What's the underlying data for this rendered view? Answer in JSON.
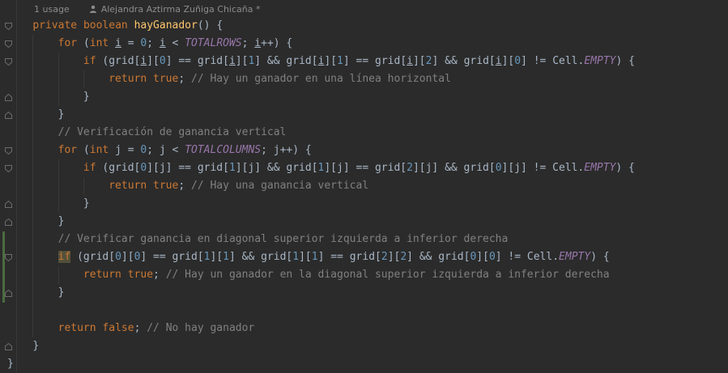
{
  "hint": {
    "usages": "1 usage",
    "author": "Alejandra Aztirma Zuñiga Chicaña *"
  },
  "code": [
    {
      "indent": 4,
      "tokens": [
        [
          "kw",
          "private "
        ],
        [
          "kw",
          "boolean "
        ],
        [
          "fn",
          "hayGanador"
        ],
        [
          "p",
          "() {"
        ]
      ]
    },
    {
      "indent": 8,
      "tokens": [
        [
          "kw",
          "for "
        ],
        [
          "p",
          "("
        ],
        [
          "kw",
          "int "
        ],
        [
          "ul",
          "i"
        ],
        [
          "p",
          " = "
        ],
        [
          "num",
          "0"
        ],
        [
          "p",
          "; "
        ],
        [
          "ul",
          "i"
        ],
        [
          "p",
          " < "
        ],
        [
          "cst",
          "TOTALROWS"
        ],
        [
          "p",
          "; "
        ],
        [
          "ul",
          "i"
        ],
        [
          "p",
          "++) {"
        ]
      ]
    },
    {
      "indent": 12,
      "tokens": [
        [
          "kw",
          "if "
        ],
        [
          "p",
          "(grid["
        ],
        [
          "ul",
          "i"
        ],
        [
          "p",
          "]["
        ],
        [
          "num",
          "0"
        ],
        [
          "p",
          "] == grid["
        ],
        [
          "ul",
          "i"
        ],
        [
          "p",
          "]["
        ],
        [
          "num",
          "1"
        ],
        [
          "p",
          "] && grid["
        ],
        [
          "ul",
          "i"
        ],
        [
          "p",
          "]["
        ],
        [
          "num",
          "1"
        ],
        [
          "p",
          "] == grid["
        ],
        [
          "ul",
          "i"
        ],
        [
          "p",
          "]["
        ],
        [
          "num",
          "2"
        ],
        [
          "p",
          "] && grid["
        ],
        [
          "ul",
          "i"
        ],
        [
          "p",
          "]["
        ],
        [
          "num",
          "0"
        ],
        [
          "p",
          "] != Cell."
        ],
        [
          "cst",
          "EMPTY"
        ],
        [
          "p",
          ") {"
        ]
      ]
    },
    {
      "indent": 16,
      "tokens": [
        [
          "kw",
          "return "
        ],
        [
          "kw",
          "true"
        ],
        [
          "p",
          "; "
        ],
        [
          "cmt",
          "// Hay un ganador en una línea horizontal"
        ]
      ]
    },
    {
      "indent": 12,
      "tokens": [
        [
          "p",
          "}"
        ]
      ]
    },
    {
      "indent": 8,
      "tokens": [
        [
          "p",
          "}"
        ]
      ]
    },
    {
      "indent": 8,
      "tokens": [
        [
          "cmt",
          "// Verificación de ganancia vertical"
        ]
      ]
    },
    {
      "indent": 8,
      "tokens": [
        [
          "kw",
          "for "
        ],
        [
          "p",
          "("
        ],
        [
          "kw",
          "int "
        ],
        [
          "p",
          "j = "
        ],
        [
          "num",
          "0"
        ],
        [
          "p",
          "; j < "
        ],
        [
          "cst",
          "TOTALCOLUMNS"
        ],
        [
          "p",
          "; j++) {"
        ]
      ]
    },
    {
      "indent": 12,
      "tokens": [
        [
          "kw",
          "if "
        ],
        [
          "p",
          "(grid["
        ],
        [
          "num",
          "0"
        ],
        [
          "p",
          "][j] == grid["
        ],
        [
          "num",
          "1"
        ],
        [
          "p",
          "][j] && grid["
        ],
        [
          "num",
          "1"
        ],
        [
          "p",
          "][j] == grid["
        ],
        [
          "num",
          "2"
        ],
        [
          "p",
          "][j] && grid["
        ],
        [
          "num",
          "0"
        ],
        [
          "p",
          "][j] != Cell."
        ],
        [
          "cst",
          "EMPTY"
        ],
        [
          "p",
          ") {"
        ]
      ]
    },
    {
      "indent": 16,
      "tokens": [
        [
          "kw",
          "return "
        ],
        [
          "kw",
          "true"
        ],
        [
          "p",
          "; "
        ],
        [
          "cmt",
          "// Hay una ganancia vertical"
        ]
      ]
    },
    {
      "indent": 12,
      "tokens": [
        [
          "p",
          "}"
        ]
      ]
    },
    {
      "indent": 8,
      "tokens": [
        [
          "p",
          "}"
        ]
      ]
    },
    {
      "indent": 8,
      "tokens": [
        [
          "cmt",
          "// Verificar ganancia en diagonal superior izquierda a inferior derecha"
        ]
      ]
    },
    {
      "indent": 8,
      "tokens": [
        [
          "kwhl",
          "if"
        ],
        [
          "p",
          " (grid["
        ],
        [
          "num",
          "0"
        ],
        [
          "p",
          "]["
        ],
        [
          "num",
          "0"
        ],
        [
          "p",
          "] == grid["
        ],
        [
          "num",
          "1"
        ],
        [
          "p",
          "]["
        ],
        [
          "num",
          "1"
        ],
        [
          "p",
          "] && grid["
        ],
        [
          "num",
          "1"
        ],
        [
          "p",
          "]["
        ],
        [
          "num",
          "1"
        ],
        [
          "p",
          "] == grid["
        ],
        [
          "num",
          "2"
        ],
        [
          "p",
          "]["
        ],
        [
          "num",
          "2"
        ],
        [
          "p",
          "] && grid["
        ],
        [
          "num",
          "0"
        ],
        [
          "p",
          "]["
        ],
        [
          "num",
          "0"
        ],
        [
          "p",
          "] != Cell."
        ],
        [
          "cst",
          "EMPTY"
        ],
        [
          "p",
          ") {"
        ]
      ]
    },
    {
      "indent": 12,
      "tokens": [
        [
          "kw",
          "return "
        ],
        [
          "kw",
          "true"
        ],
        [
          "p",
          "; "
        ],
        [
          "cmt",
          "// Hay un ganador en la diagonal superior izquierda a inferior derecha"
        ]
      ]
    },
    {
      "indent": 8,
      "tokens": [
        [
          "p",
          "}"
        ]
      ]
    },
    {
      "indent": 0,
      "tokens": []
    },
    {
      "indent": 8,
      "tokens": [
        [
          "kw",
          "return "
        ],
        [
          "kw",
          "false"
        ],
        [
          "p",
          "; "
        ],
        [
          "cmt",
          "// No hay ganador"
        ]
      ]
    },
    {
      "indent": 4,
      "tokens": [
        [
          "p",
          "}"
        ]
      ]
    },
    {
      "indent": 0,
      "tokens": [
        [
          "p",
          "}"
        ]
      ]
    }
  ]
}
